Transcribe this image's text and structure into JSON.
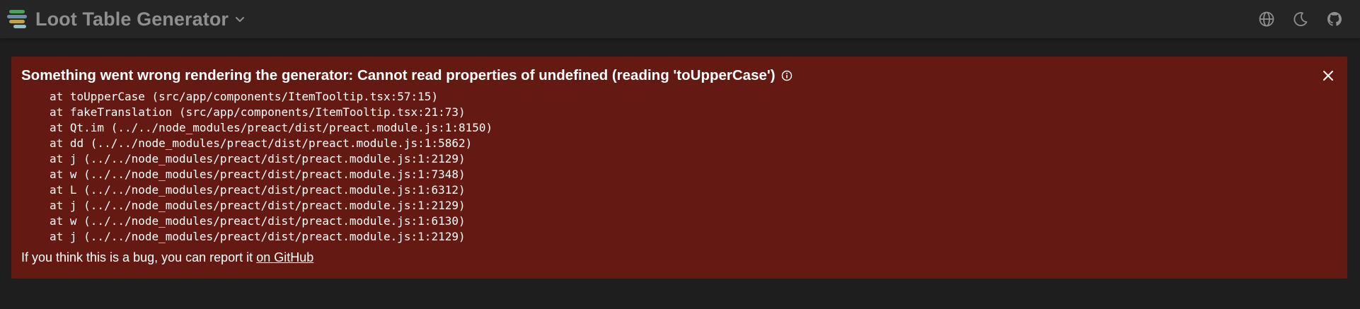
{
  "header": {
    "title": "Loot Table Generator",
    "logo_colors": [
      "#50a05a",
      "#6b8fb0",
      "#bfa34a",
      "#8fc0c8"
    ],
    "actions": [
      {
        "name": "language-icon",
        "label": "Language"
      },
      {
        "name": "theme-toggle-icon",
        "label": "Theme"
      },
      {
        "name": "github-icon",
        "label": "GitHub"
      }
    ]
  },
  "error": {
    "title": "Something went wrong rendering the generator: Cannot read properties of undefined (reading 'toUpperCase')",
    "stack": [
      "at toUpperCase (src/app/components/ItemTooltip.tsx:57:15)",
      "at fakeTranslation (src/app/components/ItemTooltip.tsx:21:73)",
      "at Qt.im (../../node_modules/preact/dist/preact.module.js:1:8150)",
      "at dd (../../node_modules/preact/dist/preact.module.js:1:5862)",
      "at j (../../node_modules/preact/dist/preact.module.js:1:2129)",
      "at w (../../node_modules/preact/dist/preact.module.js:1:7348)",
      "at L (../../node_modules/preact/dist/preact.module.js:1:6312)",
      "at j (../../node_modules/preact/dist/preact.module.js:1:2129)",
      "at w (../../node_modules/preact/dist/preact.module.js:1:6130)",
      "at j (../../node_modules/preact/dist/preact.module.js:1:2129)"
    ],
    "bug_text": "If you think this is a bug, you can report it ",
    "bug_link": "on GitHub"
  },
  "colors": {
    "background": "#1e1e1e",
    "topbar": "#252525",
    "error_panel": "#641a12",
    "icon": "#8f8f8f"
  }
}
